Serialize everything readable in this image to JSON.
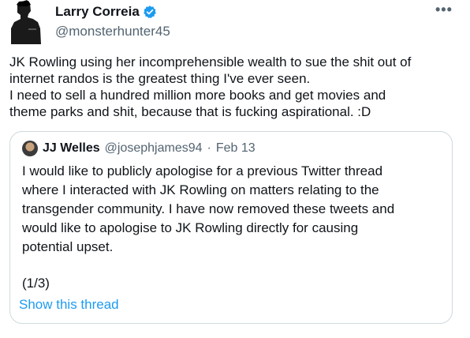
{
  "author": {
    "display_name": "Larry Correia",
    "handle": "@monsterhunter45",
    "verified_icon": "verified-badge-icon",
    "more_label": "•••"
  },
  "tweet": {
    "lines": [
      "JK Rowling using her incomprehensible wealth to sue the shit out of",
      "internet randos is the greatest thing I've ever seen.",
      "I need to sell a hundred million more books and get movies and",
      "theme parks and shit, because that is fucking aspirational. :D"
    ]
  },
  "quoted": {
    "display_name": "JJ Welles",
    "handle": "@josephjames94",
    "separator": "·",
    "date": "Feb 13",
    "lines": [
      "I would like to publicly apologise for a previous Twitter thread",
      "where I interacted with JK Rowling on matters relating to the",
      "transgender community. I have now removed these tweets and",
      "would like to apologise to JK Rowling directly for causing",
      "potential upset."
    ],
    "thread_count": "(1/3)",
    "show_thread_label": "Show this thread"
  },
  "colors": {
    "text": "#0f1419",
    "secondary": "#536471",
    "link": "#1d9bf0",
    "border": "#cfd9de"
  }
}
